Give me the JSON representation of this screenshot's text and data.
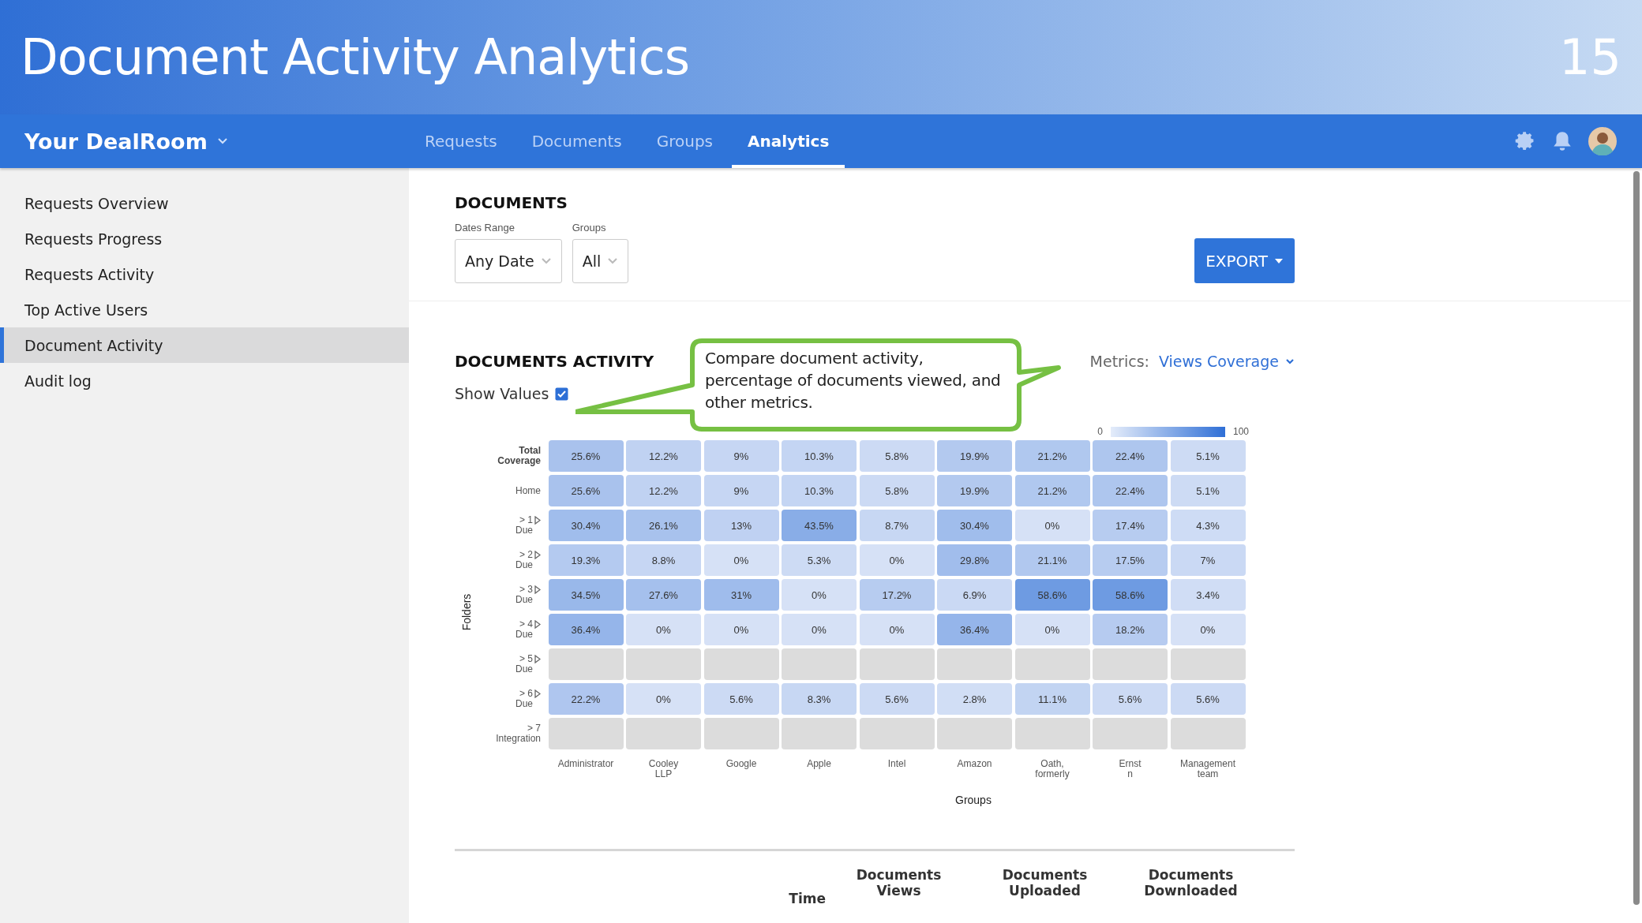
{
  "slide": {
    "title": "Document Activity Analytics",
    "page_number": "15"
  },
  "navbar": {
    "brand": "Your DealRoom",
    "tabs": [
      {
        "label": "Requests",
        "selected": false
      },
      {
        "label": "Documents",
        "selected": false
      },
      {
        "label": "Groups",
        "selected": false
      },
      {
        "label": "Analytics",
        "selected": true
      }
    ]
  },
  "sidebar": {
    "items": [
      {
        "label": "Requests Overview",
        "selected": false
      },
      {
        "label": "Requests Progress",
        "selected": false
      },
      {
        "label": "Requests Activity",
        "selected": false
      },
      {
        "label": "Top Active Users",
        "selected": false
      },
      {
        "label": "Document Activity",
        "selected": true
      },
      {
        "label": "Audit log",
        "selected": false
      }
    ]
  },
  "documents": {
    "title": "DOCUMENTS",
    "filters": [
      {
        "label": "Dates Range",
        "value": "Any Date"
      },
      {
        "label": "Groups",
        "value": "All"
      }
    ],
    "export_button": "EXPORT"
  },
  "activity": {
    "title": "DOCUMENTS ACTIVITY",
    "show_values": {
      "label": "Show Values",
      "checked": true
    },
    "metrics": {
      "label": "Metrics:",
      "value": "Views Coverage"
    },
    "callout": "Compare document activity, percentage of documents viewed, and other metrics.",
    "legend": {
      "min": "0",
      "max": "100"
    },
    "heatmap": {
      "y_title": "Folders",
      "x_title": "Groups",
      "x_axis_labels": [
        "Administrator",
        "Cooley LLP",
        "Google",
        "Apple",
        "Intel",
        "Amazon",
        "Oath, formerly",
        "Ernst n",
        "Management team"
      ],
      "rows": [
        {
          "label": [
            "Total",
            "Coverage"
          ],
          "bold": true,
          "marker": false,
          "cells": [
            "25.6%",
            "12.2%",
            "9%",
            "10.3%",
            "5.8%",
            "19.9%",
            "21.2%",
            "22.4%",
            "5.1%"
          ]
        },
        {
          "label": [
            "Home"
          ],
          "bold": false,
          "marker": false,
          "cells": [
            "25.6%",
            "12.2%",
            "9%",
            "10.3%",
            "5.8%",
            "19.9%",
            "21.2%",
            "22.4%",
            "5.1%"
          ]
        },
        {
          "label": [
            "> 1",
            "Due"
          ],
          "bold": false,
          "marker": true,
          "cells": [
            "30.4%",
            "26.1%",
            "13%",
            "43.5%",
            "8.7%",
            "30.4%",
            "0%",
            "17.4%",
            "4.3%"
          ]
        },
        {
          "label": [
            "> 2",
            "Due"
          ],
          "bold": false,
          "marker": true,
          "cells": [
            "19.3%",
            "8.8%",
            "0%",
            "5.3%",
            "0%",
            "29.8%",
            "21.1%",
            "17.5%",
            "7%"
          ]
        },
        {
          "label": [
            "> 3",
            "Due"
          ],
          "bold": false,
          "marker": true,
          "cells": [
            "34.5%",
            "27.6%",
            "31%",
            "0%",
            "17.2%",
            "6.9%",
            "58.6%",
            "58.6%",
            "3.4%"
          ]
        },
        {
          "label": [
            "> 4",
            "Due"
          ],
          "bold": false,
          "marker": true,
          "cells": [
            "36.4%",
            "0%",
            "0%",
            "0%",
            "0%",
            "36.4%",
            "0%",
            "18.2%",
            "0%"
          ]
        },
        {
          "label": [
            "> 5",
            "Due"
          ],
          "bold": false,
          "marker": true,
          "cells": [
            null,
            null,
            null,
            null,
            null,
            null,
            null,
            null,
            null
          ]
        },
        {
          "label": [
            "> 6",
            "Due"
          ],
          "bold": false,
          "marker": true,
          "cells": [
            "22.2%",
            "0%",
            "5.6%",
            "8.3%",
            "5.6%",
            "2.8%",
            "11.1%",
            "5.6%",
            "5.6%"
          ]
        },
        {
          "label": [
            "> 7",
            "Integration"
          ],
          "bold": false,
          "marker": false,
          "cells": [
            null,
            null,
            null,
            null,
            null,
            null,
            null,
            null,
            null
          ]
        }
      ]
    }
  },
  "table": {
    "columns": [
      "Time",
      "Documents Views",
      "Documents Uploaded",
      "Documents Downloaded"
    ]
  }
}
